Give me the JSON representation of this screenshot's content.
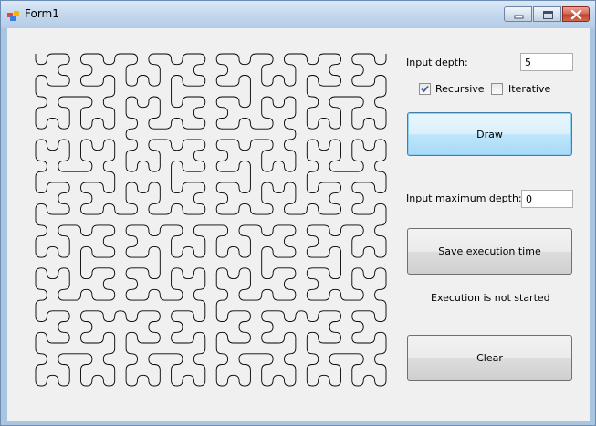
{
  "window": {
    "title": "Form1",
    "icon": "windows-form-icon"
  },
  "controls": {
    "input_depth_label": "Input depth:",
    "input_depth_value": "5",
    "recursive_label": "Recursive",
    "recursive_checked": true,
    "iterative_label": "Iterative",
    "iterative_checked": false,
    "draw_button": "Draw",
    "input_max_depth_label": "Input maximum depth:",
    "input_max_depth_value": "0",
    "save_button": "Save execution time",
    "status_text": "Execution is not started",
    "clear_button": "Clear"
  },
  "canvas": {
    "content": "hilbert-curve-fractal",
    "depth": 5
  }
}
